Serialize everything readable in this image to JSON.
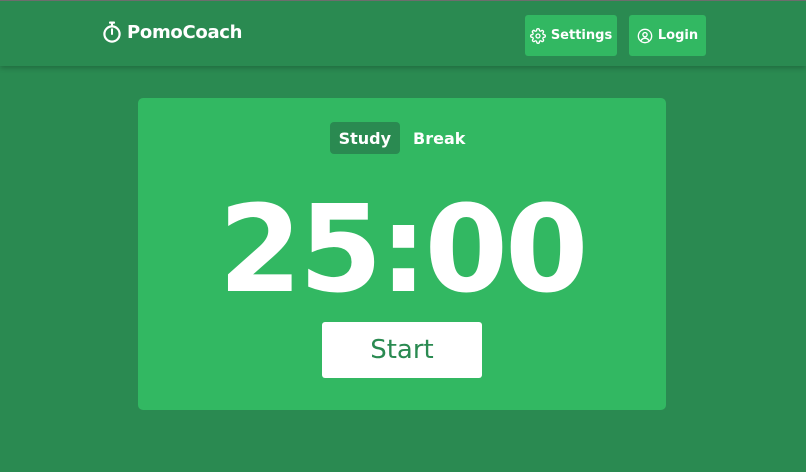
{
  "app": {
    "name": "PomoCoach",
    "logo_icon": "stopwatch-icon"
  },
  "nav": {
    "settings_label": "Settings",
    "settings_icon": "gear-icon",
    "login_label": "Login",
    "login_icon": "user-circle-icon"
  },
  "timer": {
    "tabs": [
      {
        "label": "Study",
        "active": true
      },
      {
        "label": "Break",
        "active": false
      }
    ],
    "display": "25:00",
    "start_label": "Start"
  },
  "colors": {
    "background": "#2a8a51",
    "card": "#32b862",
    "active_tab": "#2a8a51",
    "text": "#ffffff",
    "start_text": "#2a8a51"
  }
}
